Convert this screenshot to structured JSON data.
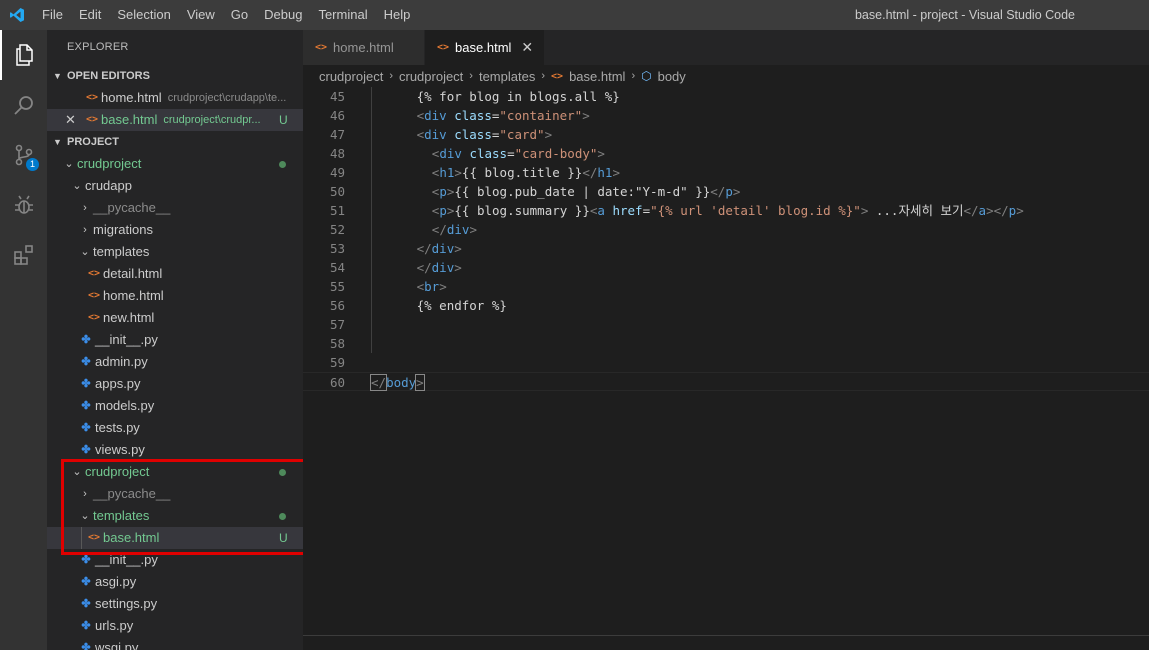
{
  "menu": [
    "File",
    "Edit",
    "Selection",
    "View",
    "Go",
    "Debug",
    "Terminal",
    "Help"
  ],
  "window_title": "base.html - project - Visual Studio Code",
  "activity": {
    "scm_badge": "1"
  },
  "explorer": {
    "title": "EXPLORER",
    "open_editors_label": "OPEN EDITORS",
    "open_editors": [
      {
        "name": "home.html",
        "path": "crudproject\\crudapp\\te..."
      },
      {
        "name": "base.html",
        "path": "crudproject\\crudpr...",
        "status": "U"
      }
    ],
    "project_label": "PROJECT",
    "tree": [
      {
        "label": "crudproject"
      },
      {
        "label": "crudapp"
      },
      {
        "label": "__pycache__"
      },
      {
        "label": "migrations"
      },
      {
        "label": "templates"
      },
      {
        "label": "detail.html"
      },
      {
        "label": "home.html"
      },
      {
        "label": "new.html"
      },
      {
        "label": "__init__.py"
      },
      {
        "label": "admin.py"
      },
      {
        "label": "apps.py"
      },
      {
        "label": "models.py"
      },
      {
        "label": "tests.py"
      },
      {
        "label": "views.py"
      },
      {
        "label": "crudproject"
      },
      {
        "label": "__pycache__"
      },
      {
        "label": "templates"
      },
      {
        "label": "base.html",
        "status": "U"
      },
      {
        "label": "__init__.py"
      },
      {
        "label": "asgi.py"
      },
      {
        "label": "settings.py"
      },
      {
        "label": "urls.py"
      },
      {
        "label": "wsgi.py"
      }
    ]
  },
  "tabs": [
    {
      "label": "home.html"
    },
    {
      "label": "base.html",
      "close": "✕"
    }
  ],
  "breadcrumb": [
    "crudproject",
    "crudproject",
    "templates",
    "base.html",
    "body"
  ],
  "editor": {
    "line_numbers": [
      "45",
      "46",
      "47",
      "48",
      "49",
      "50",
      "51",
      "52",
      "53",
      "54",
      "55",
      "56",
      "57",
      "58",
      "59",
      "60"
    ],
    "lines": [
      {
        "p": [
          "{% for blog in blogs.all %}"
        ]
      },
      {
        "p": [
          "<",
          "div",
          " ",
          "class",
          "=",
          "\"container\"",
          ">"
        ]
      },
      {
        "p": [
          "<",
          "div",
          " ",
          "class",
          "=",
          "\"card\"",
          ">"
        ]
      },
      {
        "p": [
          "<",
          "div",
          " ",
          "class",
          "=",
          "\"card-body\"",
          ">"
        ]
      },
      {
        "p": [
          "<",
          "h1",
          ">",
          "{{ blog.title }}",
          "</",
          "h1",
          ">"
        ]
      },
      {
        "p": [
          "<",
          "p",
          ">",
          "{{ blog.pub_date | date:\"Y-m-d\" }}",
          "</",
          "p",
          ">"
        ]
      },
      {
        "p": [
          "<",
          "p",
          ">",
          "{{ blog.summary }}",
          "<",
          "a",
          " ",
          "href",
          "=",
          "\"{% url 'detail' blog.id %}\"",
          ">",
          " ...자세히 보기",
          "</",
          "a",
          "></",
          "p",
          ">"
        ]
      },
      {
        "p": [
          "</",
          "div",
          ">"
        ]
      },
      {
        "p": [
          "</",
          "div",
          ">"
        ]
      },
      {
        "p": [
          "</",
          "div",
          ">"
        ]
      },
      {
        "p": [
          "<",
          "br",
          ">"
        ]
      },
      {
        "p": [
          "{% endfor %}"
        ]
      },
      {
        "p": []
      },
      {
        "p": []
      },
      {
        "p": []
      },
      {
        "p": [
          "</",
          "body",
          ">"
        ]
      }
    ]
  }
}
